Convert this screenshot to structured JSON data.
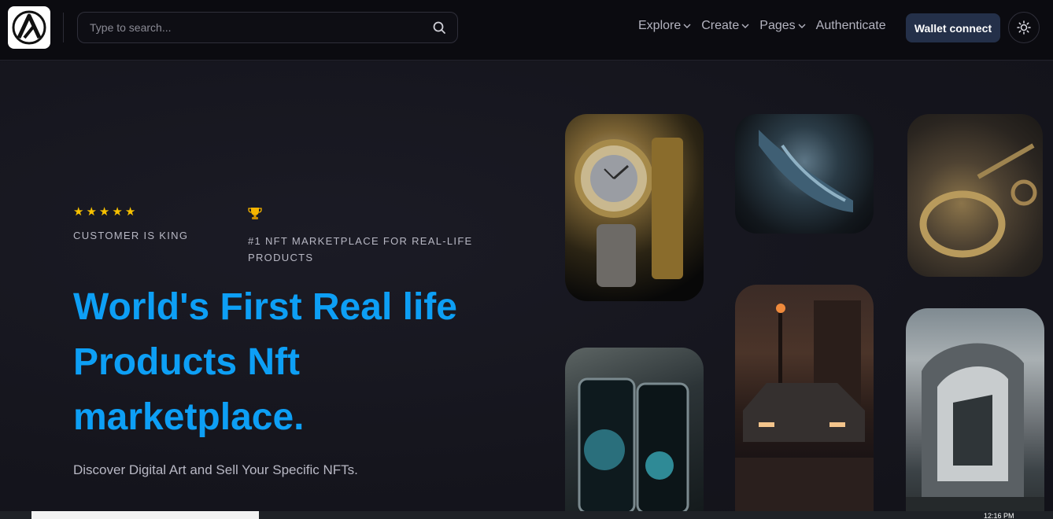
{
  "header": {
    "logo_name": "brand-logo",
    "search": {
      "placeholder": "Type to search...",
      "value": ""
    },
    "nav": [
      {
        "label": "Explore",
        "has_dropdown": true
      },
      {
        "label": "Create",
        "has_dropdown": true
      },
      {
        "label": "Pages",
        "has_dropdown": true
      },
      {
        "label": "Authenticate",
        "has_dropdown": false
      }
    ],
    "wallet_button": "Wallet connect",
    "theme_icon": "sun-icon"
  },
  "hero": {
    "badges": [
      {
        "icon": "star-rating-icon",
        "rating": 5,
        "text": "CUSTOMER IS KING"
      },
      {
        "icon": "trophy-icon",
        "text": "#1 NFT MARKETPLACE FOR REAL-LIFE PRODUCTS"
      }
    ],
    "title": "World's First Real life Products Nft marketplace.",
    "subtitle": "Discover Digital Art and Sell Your Specific NFTs."
  },
  "gallery": [
    {
      "name": "luxury-watch-image"
    },
    {
      "name": "sneaker-image"
    },
    {
      "name": "gold-jewelry-image"
    },
    {
      "name": "smartphone-image"
    },
    {
      "name": "muscle-car-image"
    },
    {
      "name": "modern-building-image"
    }
  ],
  "taskbar": {
    "time": "12:16 PM"
  },
  "colors": {
    "accent": "#0d9ff5",
    "button_bg": "#243049",
    "star": "#f7c100",
    "background": "#14141c"
  }
}
